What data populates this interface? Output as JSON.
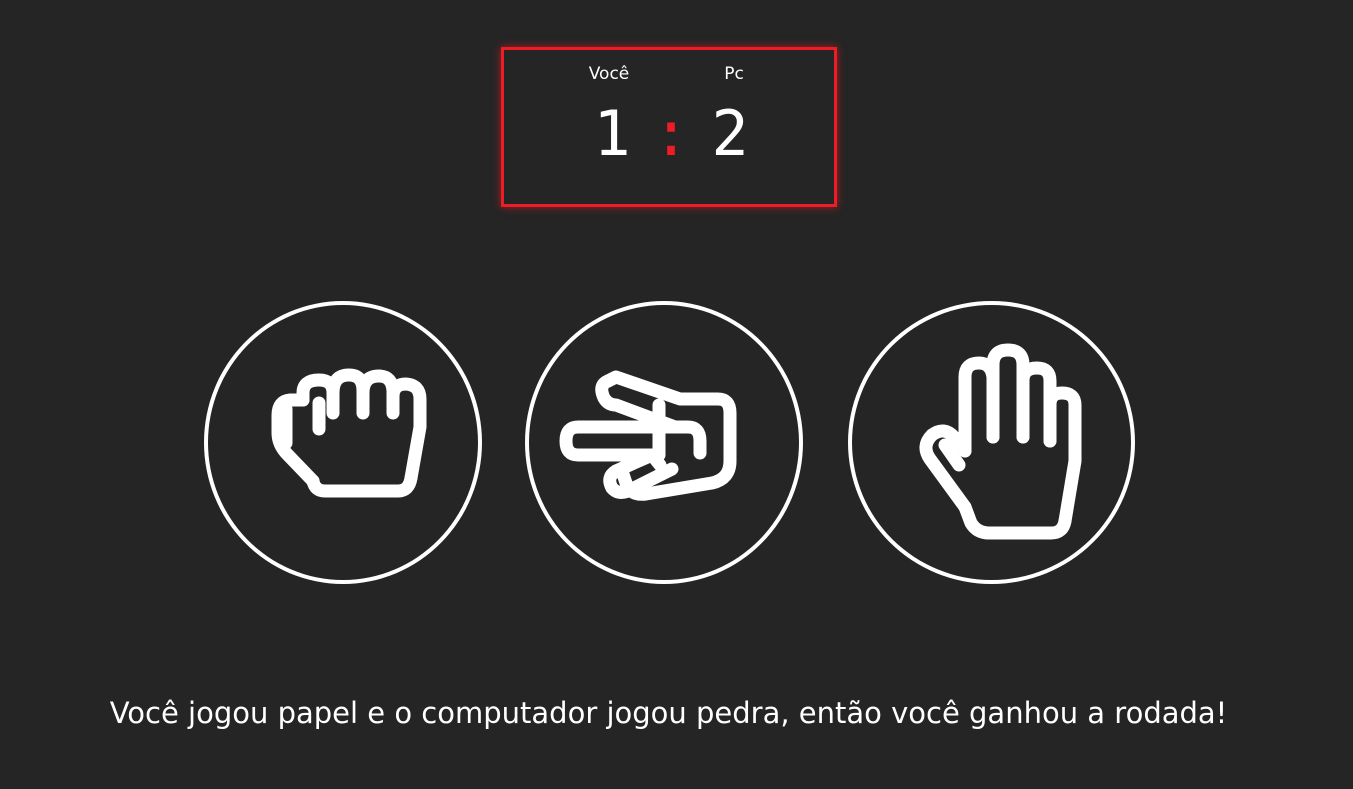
{
  "scoreboard": {
    "player_label": "Você",
    "computer_label": "Pc",
    "player_score": "1",
    "separator": ":",
    "computer_score": "2",
    "border_color": "#ee1c24"
  },
  "choices": [
    {
      "id": "rock",
      "icon": "fist-icon"
    },
    {
      "id": "scissors",
      "icon": "scissors-hand-icon"
    },
    {
      "id": "paper",
      "icon": "open-hand-icon"
    }
  ],
  "result_message": "Você jogou papel e o computador jogou pedra, então você ganhou a rodada!",
  "colors": {
    "background": "#252525",
    "foreground": "#ffffff",
    "accent": "#ee1c24"
  }
}
